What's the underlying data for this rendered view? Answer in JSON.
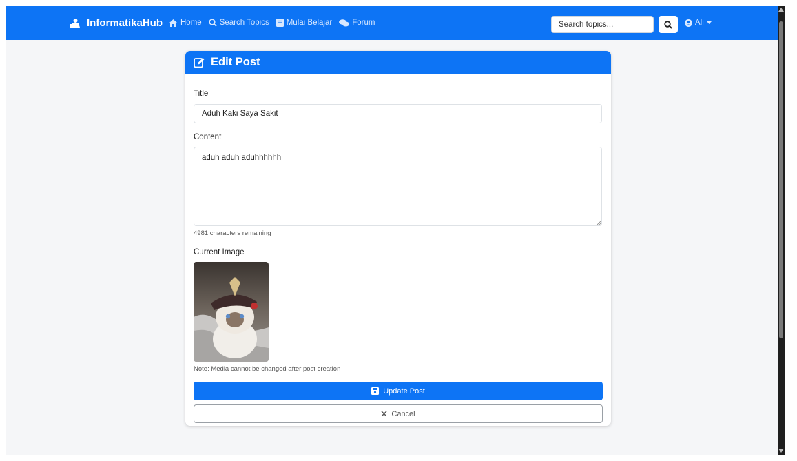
{
  "navbar": {
    "brand": "InformatikaHub",
    "items": [
      {
        "label": "Home",
        "icon": "home-icon"
      },
      {
        "label": "Search Topics",
        "icon": "search-icon"
      },
      {
        "label": "Mulai Belajar",
        "icon": "book-icon"
      },
      {
        "label": "Forum",
        "icon": "comments-icon"
      }
    ],
    "search_placeholder": "Search topics...",
    "user": "Ali"
  },
  "card": {
    "header": "Edit Post",
    "title_label": "Title",
    "title_value": "Aduh Kaki Saya Sakit",
    "content_label": "Content",
    "content_value": "aduh aduh aduhhhhhh",
    "chars_remaining": "4981 characters remaining",
    "image_label": "Current Image",
    "media_note": "Note: Media cannot be changed after post creation",
    "update_button": "Update Post",
    "cancel_button": "Cancel"
  },
  "colors": {
    "primary": "#0d74f5",
    "background": "#f5f6f8"
  }
}
